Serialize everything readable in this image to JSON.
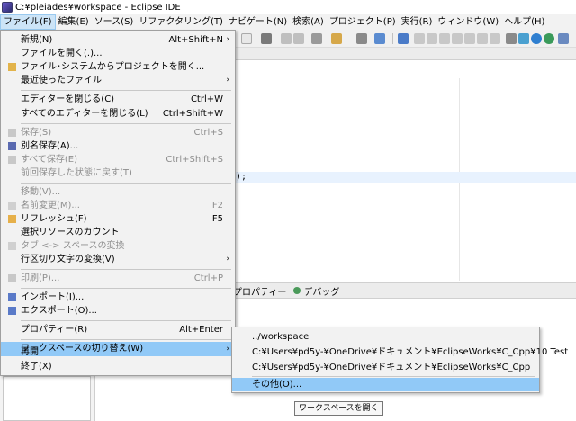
{
  "window": {
    "title": "C:¥pleiades¥workspace - Eclipse IDE"
  },
  "menubar": {
    "items": [
      "ファイル(F)",
      "編集(E)",
      "ソース(S)",
      "リファクタリング(T)",
      "ナビゲート(N)",
      "検索(A)",
      "プロジェクト(P)",
      "実行(R)",
      "ウィンドウ(W)",
      "ヘルプ(H)"
    ]
  },
  "file_menu": {
    "new": {
      "label": "新規(N)",
      "shortcut": "Alt+Shift+N"
    },
    "open_file": {
      "label": "ファイルを開く(.)..."
    },
    "open_projects": {
      "label": "ファイル･システムからプロジェクトを開く..."
    },
    "recent_files": {
      "label": "最近使ったファイル"
    },
    "close_editor": {
      "label": "エディターを閉じる(C)",
      "shortcut": "Ctrl+W"
    },
    "close_all": {
      "label": "すべてのエディターを閉じる(L)",
      "shortcut": "Ctrl+Shift+W"
    },
    "save": {
      "label": "保存(S)",
      "shortcut": "Ctrl+S"
    },
    "save_as": {
      "label": "別名保存(A)..."
    },
    "save_all": {
      "label": "すべて保存(E)",
      "shortcut": "Ctrl+Shift+S"
    },
    "revert": {
      "label": "前回保存した状態に戻す(T)"
    },
    "move": {
      "label": "移動(V)..."
    },
    "rename": {
      "label": "名前変更(M)...",
      "shortcut": "F2"
    },
    "refresh": {
      "label": "リフレッシュ(F)",
      "shortcut": "F5"
    },
    "count_resources": {
      "label": "選択リソースのカウント"
    },
    "tabs_spaces": {
      "label": "タブ <-> スペースの変換"
    },
    "line_delimiters": {
      "label": "行区切り文字の変換(V)"
    },
    "print": {
      "label": "印刷(P)...",
      "shortcut": "Ctrl+P"
    },
    "import": {
      "label": "インポート(I)..."
    },
    "export": {
      "label": "エクスポート(O)..."
    },
    "properties": {
      "label": "プロパティー(R)",
      "shortcut": "Alt+Enter"
    },
    "switch_workspace": {
      "label": "ワークスペースの切り替え(W)"
    },
    "restart": {
      "label": "再開"
    },
    "exit": {
      "label": "終了(X)"
    }
  },
  "workspace_submenu": {
    "items": [
      "../workspace",
      "C:¥Users¥pd5y-¥OneDrive¥ドキュメント¥EclipseWorks¥C_Cpp¥10 Test",
      "C:¥Users¥pd5y-¥OneDrive¥ドキュメント¥EclipseWorks¥C_Cpp"
    ],
    "other": "その他(O)..."
  },
  "tooltip": "ワークスペースを開く",
  "editor": {
    "code_fragment": ");"
  },
  "bottom_tabs": [
    {
      "label": "プロパティー"
    },
    {
      "label": "デバッグ"
    }
  ],
  "colors": {
    "highlight": "#91c9f7",
    "menu_bg": "#f2f2f2",
    "disabled_text": "#8e8e8e"
  }
}
